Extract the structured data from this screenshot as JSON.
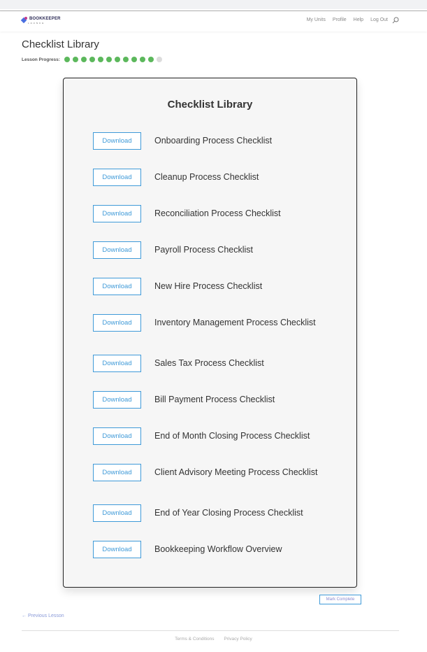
{
  "header": {
    "logo_text": "BOOKKEEPER",
    "logo_sub": "LAUNCH",
    "nav": [
      {
        "label": "My Units"
      },
      {
        "label": "Profile"
      },
      {
        "label": "Help"
      },
      {
        "label": "Log Out"
      }
    ],
    "search_icon": "search-icon"
  },
  "page": {
    "title": "Checklist Library",
    "progress_label": "Lesson Progress:",
    "progress": {
      "completed": 11,
      "total": 12
    },
    "colors": {
      "progress_done": "#5cb85c",
      "progress_todo": "#dcdcdc",
      "accent": "#3f9ad8"
    }
  },
  "card": {
    "title": "Checklist Library",
    "items": [
      {
        "button": "Download",
        "label": "Onboarding Process Checklist"
      },
      {
        "button": "Download",
        "label": "Cleanup Process Checklist"
      },
      {
        "button": "Download",
        "label": "Reconciliation Process Checklist"
      },
      {
        "button": "Download",
        "label": "Payroll Process Checklist"
      },
      {
        "button": "Download",
        "label": "New Hire Process Checklist"
      },
      {
        "button": "Download",
        "label": "Inventory Management Process Checklist"
      },
      {
        "button": "Download",
        "label": "Sales Tax Process Checklist"
      },
      {
        "button": "Download",
        "label": "Bill Payment Process Checklist"
      },
      {
        "button": "Download",
        "label": "End of Month Closing Process Checklist"
      },
      {
        "button": "Download",
        "label": "Client Advisory Meeting Process Checklist"
      },
      {
        "button": "Download",
        "label": "End of Year Closing Process Checklist"
      },
      {
        "button": "Download",
        "label": "Bookkeeping Workflow Overview"
      }
    ]
  },
  "actions": {
    "mark_complete": "Mark Complete",
    "previous_lesson": "← Previous Lesson"
  },
  "footer": {
    "links": [
      {
        "label": "Terms & Conditions"
      },
      {
        "label": "Privacy Policy"
      }
    ]
  }
}
